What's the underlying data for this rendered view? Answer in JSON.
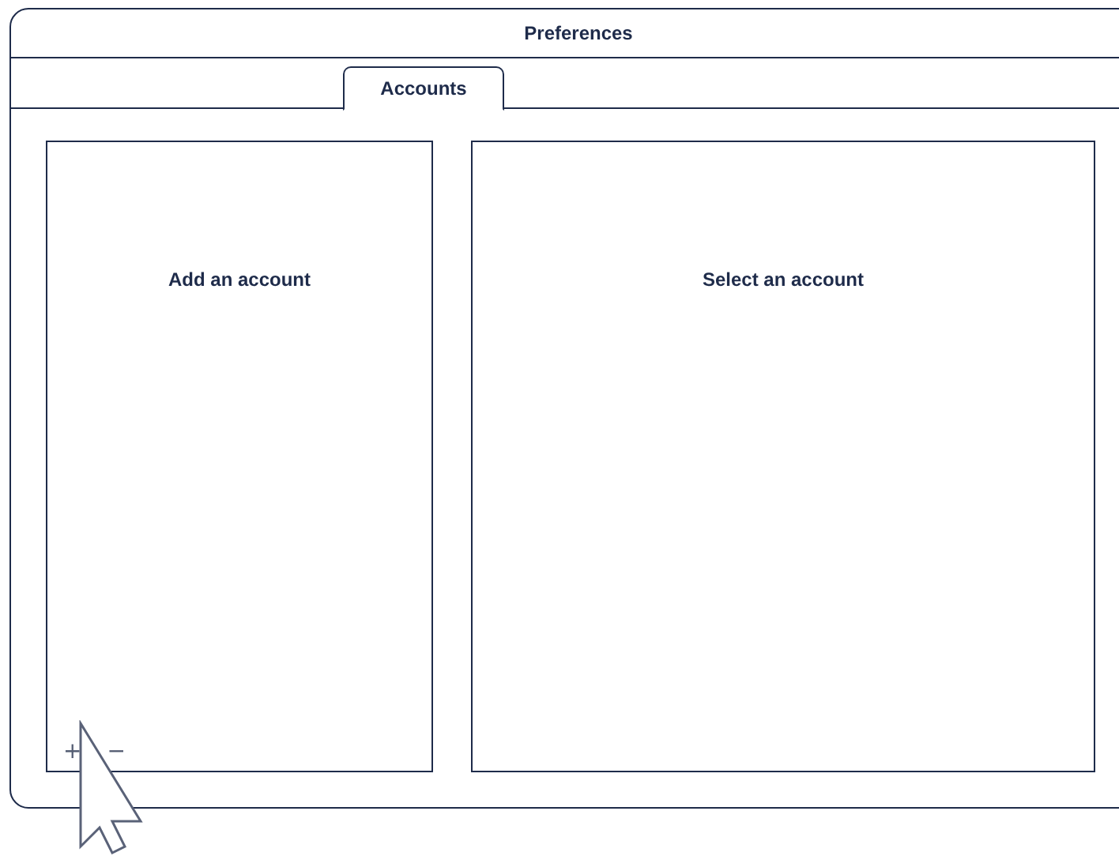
{
  "window": {
    "title": "Preferences"
  },
  "tabs": [
    {
      "label": "Accounts",
      "selected": true
    }
  ],
  "account_list": {
    "message": "Add an account",
    "buttons": [
      "+",
      "−"
    ]
  },
  "account_detail": {
    "message": "Select an account"
  }
}
